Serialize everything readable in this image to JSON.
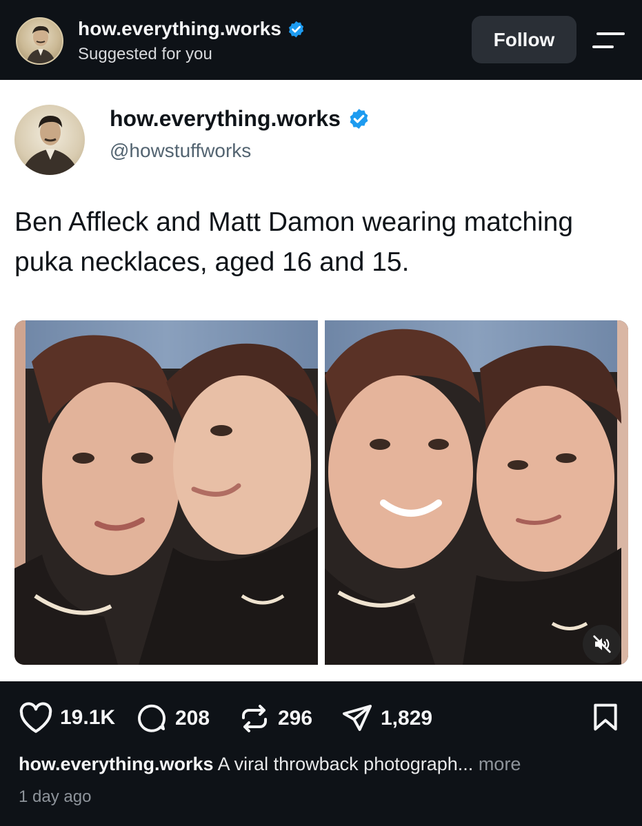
{
  "header": {
    "username": "how.everything.works",
    "subtitle": "Suggested for you",
    "follow_label": "Follow",
    "avatar_icon": "tesla-portrait-avatar",
    "verified_icon": "verified-badge-icon",
    "menu_icon": "menu-icon"
  },
  "tweet": {
    "display_name": "how.everything.works",
    "handle": "@howstuffworks",
    "text": "Ben Affleck and Matt Damon wearing matching puka necklaces, aged 16 and 15.",
    "photos": [
      {
        "name": "photobooth-photo-left"
      },
      {
        "name": "photobooth-photo-right"
      }
    ],
    "mute_icon": "muted-speaker-icon"
  },
  "actions": {
    "likes": "19.1K",
    "comments": "208",
    "reposts": "296",
    "shares": "1,829",
    "bookmark_icon": "bookmark-icon"
  },
  "caption": {
    "username": "how.everything.works",
    "text": " A viral throwback photograph...",
    "more": " more"
  },
  "timestamp": "1 day ago",
  "colors": {
    "background": "#0e1217",
    "card": "#ffffff",
    "verified": "#1d9bf0",
    "follow_button": "#2a2f36"
  }
}
